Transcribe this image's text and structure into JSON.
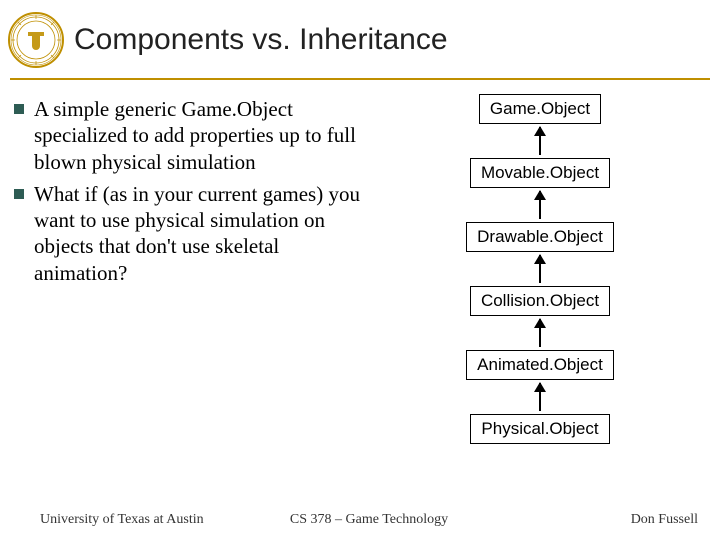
{
  "title": "Components vs. Inheritance",
  "bullets": [
    "A simple generic Game.Object specialized to add properties up to full blown physical simulation",
    "What if (as in your current games) you want to use physical simulation on objects that don't use skeletal animation?"
  ],
  "chain": [
    "Game.Object",
    "Movable.Object",
    "Drawable.Object",
    "Collision.Object",
    "Animated.Object",
    "Physical.Object"
  ],
  "footer": {
    "left": "University of Texas at Austin",
    "center": "CS 378 – Game Technology",
    "right": "Don Fussell"
  }
}
